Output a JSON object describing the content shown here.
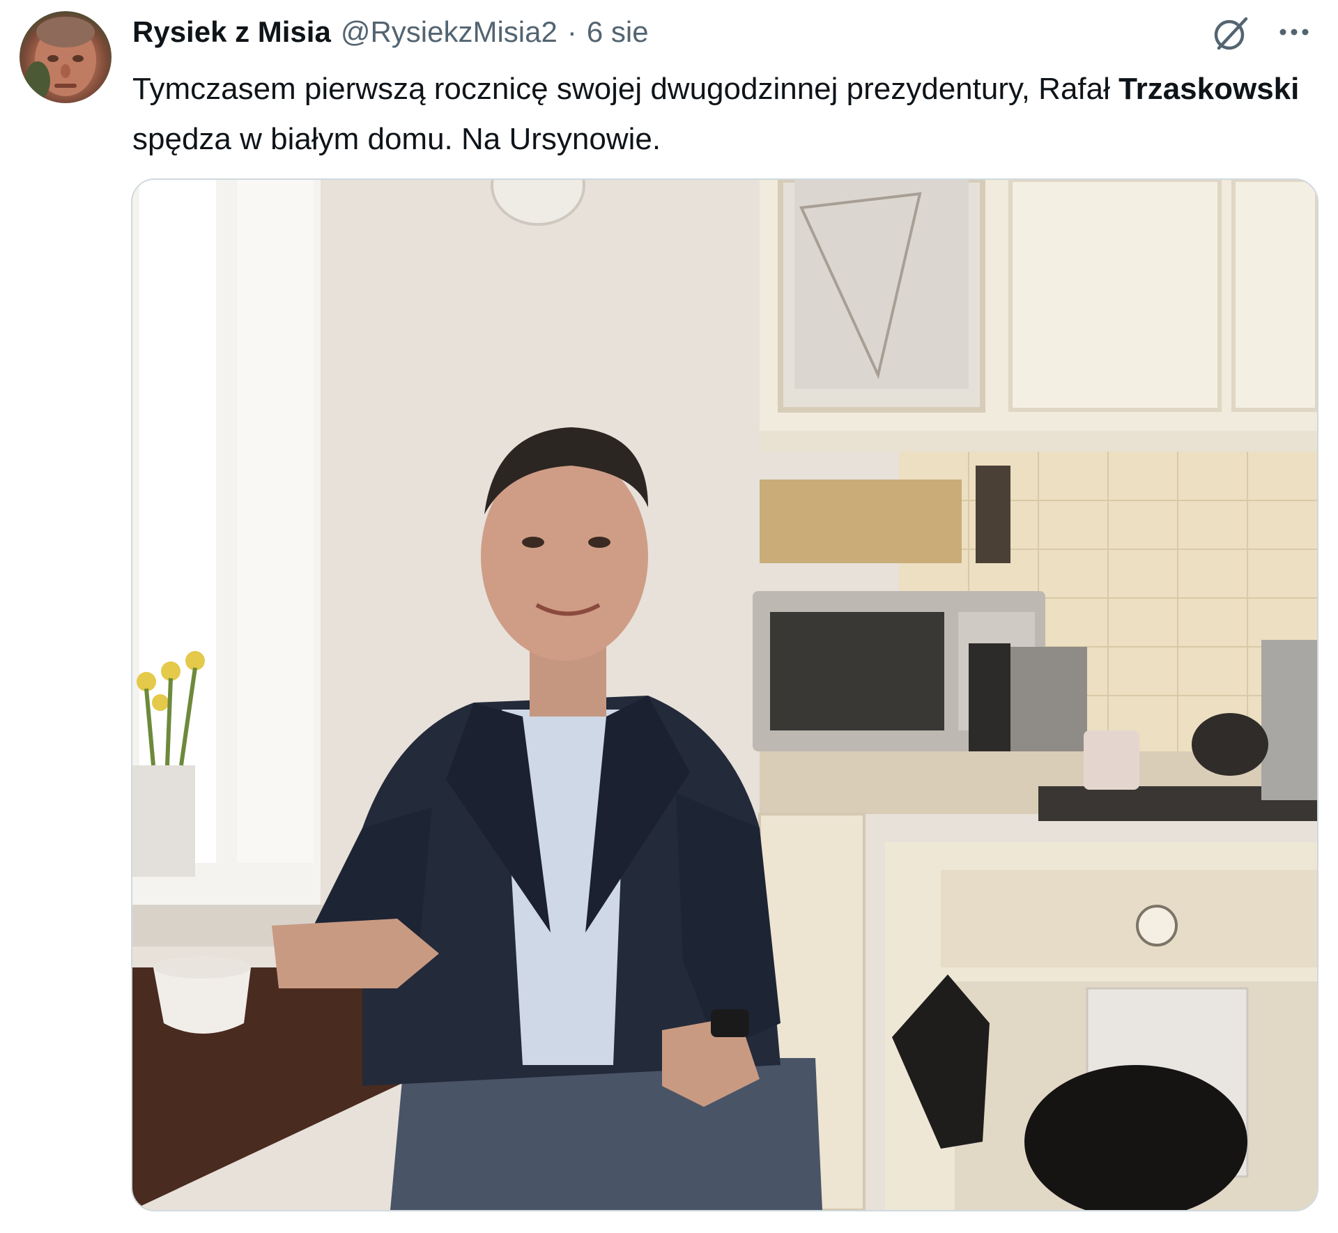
{
  "author": {
    "display_name": "Rysiek z Misia",
    "handle": "@RysiekzMisia2",
    "separator": "·",
    "date": "6 sie"
  },
  "tweet": {
    "text_before": "Tymczasem pierwszą rocznicę swojej dwugodzinnej prezydentury, Rafał ",
    "text_bold": "Trzaskowski",
    "text_after": " spędza w białym domu. Na Ursynowie."
  },
  "icons": {
    "grok": "grok-icon",
    "more": "more-icon"
  },
  "colors": {
    "text_primary": "#0f1419",
    "text_secondary": "#536471",
    "border": "#cfd9de"
  }
}
